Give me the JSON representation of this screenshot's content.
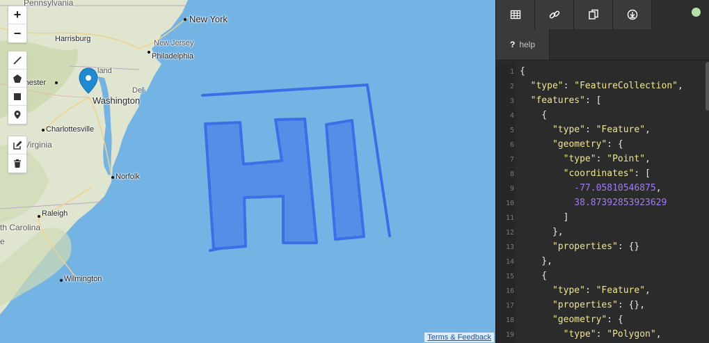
{
  "map": {
    "places": [
      {
        "id": "pennsylvania",
        "label": "Pennsylvania"
      },
      {
        "id": "new-york",
        "label": "New York"
      },
      {
        "id": "harrisburg",
        "label": "Harrisburg"
      },
      {
        "id": "new-jersey",
        "label": "New Jersey"
      },
      {
        "id": "philadelphia",
        "label": "Philadelphia"
      },
      {
        "id": "maryland",
        "label": "land"
      },
      {
        "id": "chester",
        "label": "chester"
      },
      {
        "id": "washington",
        "label": "Washington"
      },
      {
        "id": "delaware",
        "label": "Del"
      },
      {
        "id": "charlottesville",
        "label": "Charlottesville"
      },
      {
        "id": "virginia",
        "label": "Virginia"
      },
      {
        "id": "norfolk",
        "label": "Norfolk"
      },
      {
        "id": "raleigh",
        "label": "Raleigh"
      },
      {
        "id": "north-carolina",
        "label": "th Carolina"
      },
      {
        "id": "wilmington",
        "label": "Wilmington"
      }
    ],
    "zoom_in_label": "+",
    "zoom_out_label": "−",
    "attribution": "Terms & Feedback",
    "drawing_color": "#3b6fe8",
    "water_color": "#73b4e4"
  },
  "panel": {
    "tabs": [
      "table-icon",
      "link-icon",
      "paste-icon",
      "download-icon"
    ],
    "help_label": "help",
    "help_glyph": "?",
    "status_color": "#b2e2a6"
  },
  "code_lines": [
    "{",
    "  \"type\": \"FeatureCollection\",",
    "  \"features\": [",
    "    {",
    "      \"type\": \"Feature\",",
    "      \"geometry\": {",
    "        \"type\": \"Point\",",
    "        \"coordinates\": [",
    "          -77.05810546875,",
    "          38.87392853923629",
    "        ]",
    "      },",
    "      \"properties\": {}",
    "    },",
    "    {",
    "      \"type\": \"Feature\",",
    "      \"properties\": {},",
    "      \"geometry\": {",
    "        \"type\": \"Polygon\","
  ]
}
